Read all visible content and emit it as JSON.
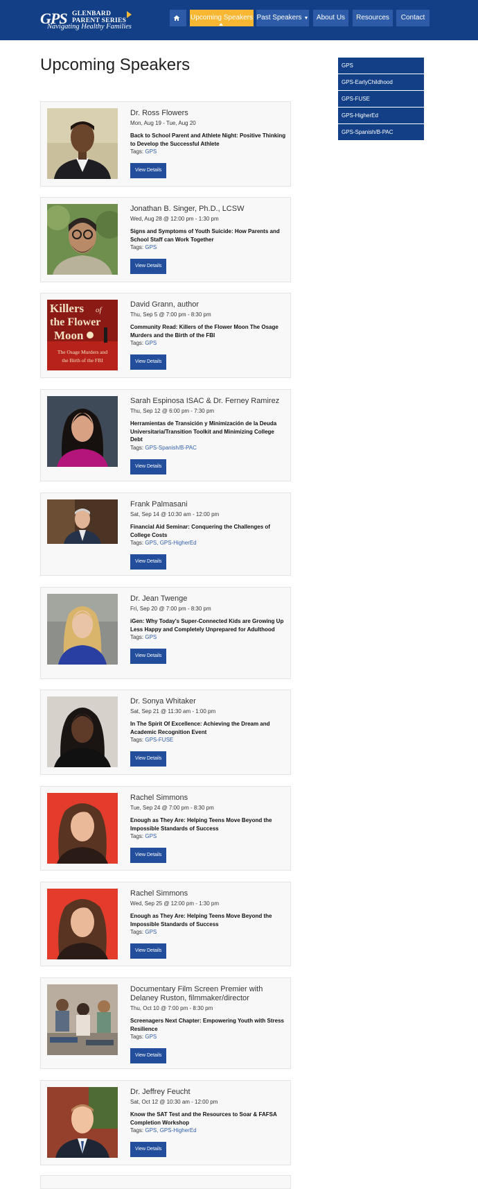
{
  "header": {
    "logo_gps": "GPS",
    "logo_line1": "GLENBARD",
    "logo_line2": "PARENT SERIES",
    "logo_tagline": "Navigating Healthy Families",
    "nav": [
      {
        "label": "Upcoming Speakers"
      },
      {
        "label": "Past Speakers"
      },
      {
        "label": "About Us"
      },
      {
        "label": "Resources"
      },
      {
        "label": "Contact"
      }
    ]
  },
  "page_title": "Upcoming Speakers",
  "sidebar": [
    "GPS",
    "GPS-EarlyChildhood",
    "GPS-FUSE",
    "GPS-HigherEd",
    "GPS-Spanish/B-PAC"
  ],
  "button_label": "View Details",
  "tags_label": "Tags:",
  "events": [
    {
      "name": "Dr. Ross Flowers",
      "date": "Mon, Aug 19 - Tue, Aug 20",
      "title": "Back to School Parent and Athlete Night: Positive Thinking to Develop the Successful Athlete",
      "tags": "GPS"
    },
    {
      "name": "Jonathan B. Singer, Ph.D., LCSW",
      "date": "Wed, Aug 28 @ 12:00 pm - 1:30 pm",
      "title": "Signs and Symptoms of Youth Suicide: How Parents and School Staff can Work Together",
      "tags": "GPS"
    },
    {
      "name": "David Grann, author",
      "date": "Thu, Sep 5 @ 7:00 pm - 8:30 pm",
      "title": "Community Read: Killers of the Flower Moon The Osage Murders and the Birth of the FBI",
      "tags": "GPS"
    },
    {
      "name": "Sarah Espinosa ISAC & Dr. Ferney Ramirez",
      "date": "Thu, Sep 12 @ 6:00 pm - 7:30 pm",
      "title": "Herramientas de Transición y Minimización de la Deuda Universitaria/Transition Toolkit and Minimizing College Debt",
      "tags": "GPS-Spanish/B-PAC"
    },
    {
      "name": "Frank Palmasani",
      "date": "Sat, Sep 14 @ 10:30 am - 12:00 pm",
      "title": "Financial Aid Seminar: Conquering the Challenges of College Costs",
      "tags": "GPS, GPS-HigherEd"
    },
    {
      "name": "Dr. Jean Twenge",
      "date": "Fri, Sep 20 @ 7:00 pm - 8:30 pm",
      "title": "iGen: Why Today's Super-Connected Kids are Growing Up Less Happy and Completely Unprepared for Adulthood",
      "tags": "GPS"
    },
    {
      "name": "Dr. Sonya Whitaker",
      "date": "Sat, Sep 21 @ 11:30 am - 1:00 pm",
      "title": "In The Spirit Of Excellence: Achieving the Dream and Academic Recognition Event",
      "tags": "GPS-FUSE"
    },
    {
      "name": "Rachel Simmons",
      "date": "Tue, Sep 24 @ 7:00 pm - 8:30 pm",
      "title": "Enough as They Are: Helping Teens Move Beyond the Impossible Standards of Success",
      "tags": "GPS"
    },
    {
      "name": "Rachel Simmons",
      "date": "Wed, Sep 25 @ 12:00 pm - 1:30 pm",
      "title": "Enough as They Are: Helping Teens Move Beyond the Impossible Standards of Success",
      "tags": "GPS"
    },
    {
      "name": "Documentary Film Screen Premier with Delaney Ruston, filmmaker/director",
      "date": "Thu, Oct 10 @ 7:00 pm - 8:30 pm",
      "title": "Screenagers Next Chapter: Empowering Youth with Stress Resilience",
      "tags": "GPS"
    },
    {
      "name": "Dr. Jeffrey Feucht",
      "date": "Sat, Oct 12 @ 10:30 am - 12:00 pm",
      "title": "Know the SAT Test and the Resources to Soar & FAFSA Completion Workshop",
      "tags": "GPS, GPS-HigherEd"
    }
  ],
  "book_cover": {
    "line1": "Killers",
    "line2": "of",
    "line3": "the Flower",
    "line4": "Moon",
    "sub1": "The Osage Murders and",
    "sub2": "the Birth of the FBI"
  }
}
